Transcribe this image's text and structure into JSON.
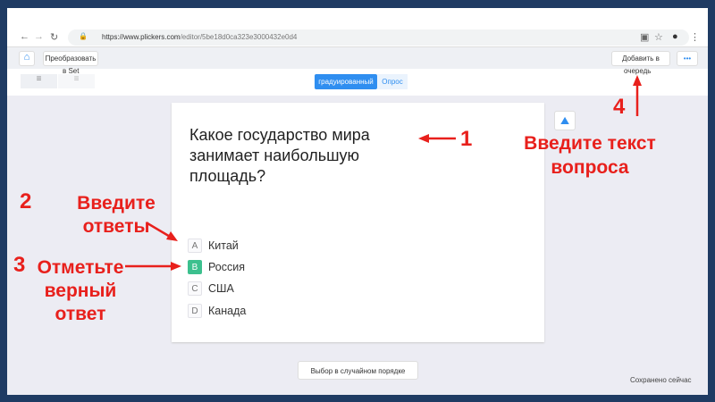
{
  "browser": {
    "url_host": "https://www.plickers.com",
    "url_path": "/editor/5be18d0ca323e3000432e0d4"
  },
  "toolbar": {
    "convert_label": "Преобразовать",
    "convert_label_2": "в Set",
    "add_label": "Добавить в",
    "add_label_2": "очередь",
    "more_label": "•••"
  },
  "tabs": [
    {
      "label": "градуированный",
      "active": true
    },
    {
      "label": "Опрос",
      "active": false
    }
  ],
  "question": {
    "text": "Какое государство мира занимает наибольшую площадь?",
    "answers": [
      {
        "letter": "A",
        "text": "Китай",
        "correct": false
      },
      {
        "letter": "B",
        "text": "Россия",
        "correct": true
      },
      {
        "letter": "C",
        "text": "США",
        "correct": false
      },
      {
        "letter": "D",
        "text": "Канада",
        "correct": false
      }
    ]
  },
  "shuffle_label": "Выбор в случайном порядке",
  "status": "Сохранено сейчас",
  "annotations": {
    "n1": "1",
    "n2": "2",
    "n3": "3",
    "n4": "4",
    "a1": "Введите текст вопроса",
    "a2": "Введите ответы",
    "a3": "Отметьте верный ответ"
  },
  "colors": {
    "accent": "#2f8ef0",
    "correct": "#3cc08e",
    "annotation": "#e8201c",
    "border": "#1f3b63"
  }
}
